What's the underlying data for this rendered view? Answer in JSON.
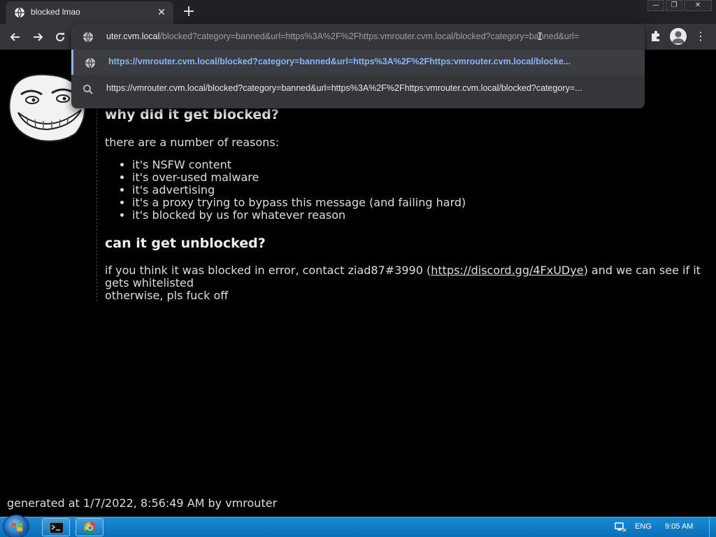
{
  "browser": {
    "tab_title": "blocked lmao",
    "tab_close": "✕",
    "newtab": "+",
    "window_controls": {
      "minimize": "—",
      "restore": "❐",
      "close": "✕"
    },
    "omnibox": {
      "host": "uter.cvm.local",
      "rest": "/blocked?category=banned&url=https%3A%2F%2Fhttps:vmrouter.cvm.local/blocked?category=banned&url="
    },
    "suggestions": [
      {
        "text": "https://vmrouter.cvm.local/blocked?category=banned&url=https%3A%2F%2Fhttps:vmrouter.cvm.local/blocke...",
        "icon": "globe-icon"
      },
      {
        "text": "https://vmrouter.cvm.local/blocked?category=banned&url=https%3A%2F%2Fhttps:vmrouter.cvm.local/blocked?category=...",
        "icon": "search-icon"
      }
    ],
    "menu": "⋮"
  },
  "page": {
    "heading_why": "why did it get blocked?",
    "reasons_intro": "there are a number of reasons:",
    "reasons": [
      "it's NSFW content",
      "it's over-used malware",
      "it's advertising",
      "it's a proxy trying to bypass this message (and failing hard)",
      "it's blocked by us for whatever reason"
    ],
    "heading_unblock": "can it get unblocked?",
    "contact_before": "if you think it was blocked in error, contact ziad87#3990 (",
    "contact_link": "https://discord.gg/4FxUDye",
    "contact_after": ") and we can see if it gets whitelisted",
    "contact_line2": "otherwise, pls fuck off",
    "footer": "generated at 1/7/2022, 8:56:49 AM by vmrouter"
  },
  "taskbar": {
    "language": "ENG",
    "time": "9:05 AM"
  }
}
